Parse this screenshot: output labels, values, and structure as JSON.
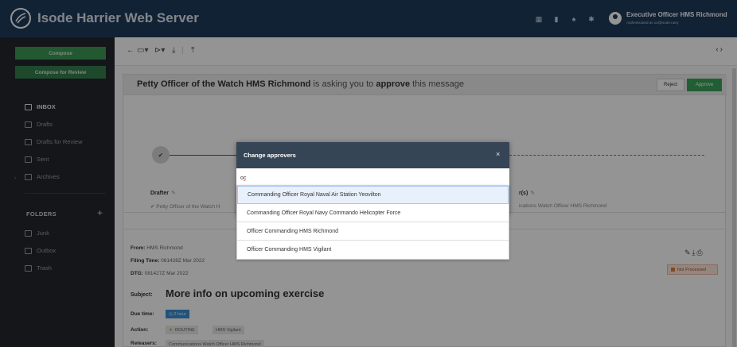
{
  "app": {
    "title": "Isode Harrier Web Server",
    "user_name": "Executive Officer HMS Richmond",
    "user_sub": "Authenticated as xo@isode.navy"
  },
  "topbar_icons": [
    "calendar-icon",
    "bookmark-icon",
    "bell-icon",
    "gear-icon"
  ],
  "sidebar": {
    "compose_label": "Compose",
    "compose_review_label": "Compose for Review",
    "nav": [
      {
        "label": "INBOX",
        "icon": "inbox-icon"
      },
      {
        "label": "Drafts",
        "icon": "drafts-icon"
      },
      {
        "label": "Drafts for Review",
        "icon": "drafts-review-icon"
      },
      {
        "label": "Sent",
        "icon": "sent-icon"
      },
      {
        "label": "Archives",
        "icon": "archive-icon"
      }
    ],
    "folders_label": "FOLDERS",
    "add_folder_label": "+",
    "folders": [
      {
        "label": "Junk",
        "icon": "folder-icon"
      },
      {
        "label": "Outbox",
        "icon": "folder-icon"
      },
      {
        "label": "Trash",
        "icon": "folder-icon"
      }
    ]
  },
  "approval": {
    "requester": "Petty Officer of the Watch HMS Richmond",
    "middle": " is asking you to ",
    "action": "approve",
    "tail": " this message",
    "reject_label": "Reject",
    "approve_label": "Approve",
    "drafter_label": "Drafter",
    "drafter_value": "✔ Petty Officer of the Watch H",
    "releasers_label": "r(s)",
    "releasers_value": "ications Watch Officer HMS Richmond"
  },
  "message": {
    "from_label": "From:",
    "from_value": "HMS Richmond",
    "filing_label": "Filing Time:",
    "filing_value": "081428Z Mar 2022",
    "dtg_label": "DTG:",
    "dtg_value": "081427Z Mar 2022",
    "subject_label": "Subject:",
    "subject_value": "More info on upcoming exercise",
    "due_label": "Due time:",
    "due_value": "2 hour",
    "action_label": "Action:",
    "action_priority": "ROUTINE",
    "action_recipient": "HMS Vigilant",
    "releasers_label": "Releasers:",
    "releasers_value": "Communications Watch Officer HMS Richmond",
    "status": "Not Processed"
  },
  "modal": {
    "title": "Change approvers",
    "close_label": "×",
    "input_value": "oc",
    "options": [
      "Commanding Officer Royal Naval Air Station Yeovilton",
      "Commanding Officer Royal Navy Commando Helicopter Force",
      "Officer Commanding HMS Richmond",
      "Officer Commanding HMS Vigilant"
    ],
    "highlighted_index": 0
  },
  "colors": {
    "topbar": "#1e3b5c",
    "sidebar": "#24272b",
    "accent_green": "#3c9a55",
    "modal_header": "#364556"
  }
}
